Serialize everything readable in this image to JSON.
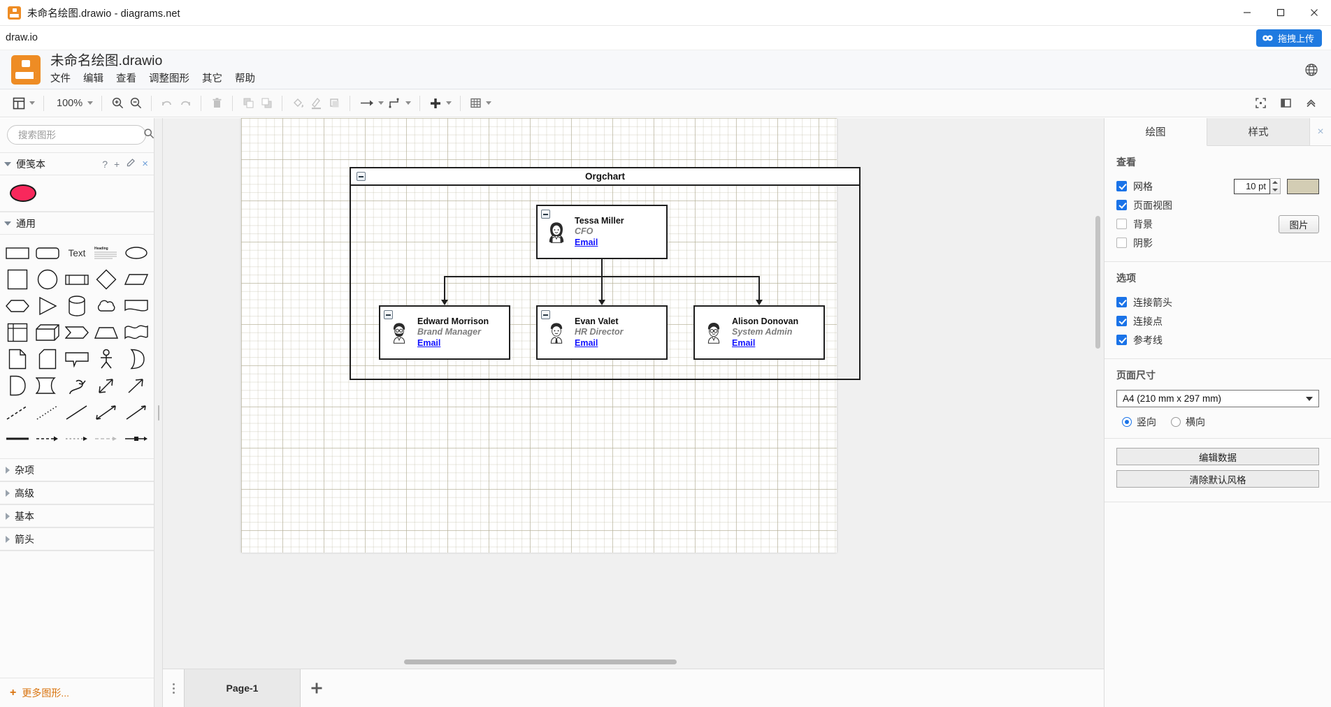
{
  "window": {
    "title": "未命名绘图.drawio - diagrams.net",
    "app_icon": "drawio-logo-icon",
    "controls": {
      "minimize": "minimize-icon",
      "maximize": "maximize-icon",
      "close": "close-icon"
    }
  },
  "brandstrip": {
    "label": "draw.io",
    "upload_button": "拖拽上传",
    "upload_icon": "cloud-upload-icon"
  },
  "header": {
    "file_name": "未命名绘图.drawio",
    "menus": [
      "文件",
      "编辑",
      "查看",
      "调整图形",
      "其它",
      "帮助"
    ],
    "language_icon": "globe-icon"
  },
  "toolbar": {
    "view_icon": "panel-layout-icon",
    "zoom_level": "100%",
    "items": [
      "zoom-in-icon",
      "zoom-out-icon",
      "undo-icon",
      "redo-icon",
      "delete-icon",
      "to-front-icon",
      "to-back-icon",
      "fill-color-icon",
      "line-color-icon",
      "shadow-icon",
      "connection-arrow-icon",
      "waypoints-icon",
      "insert-icon",
      "table-icon"
    ],
    "right_items": [
      "fullscreen-icon",
      "format-panel-icon",
      "collapse-toolbar-icon"
    ]
  },
  "sidebar": {
    "search": {
      "placeholder": "搜索图形",
      "value": "",
      "icon": "search-icon"
    },
    "sections": [
      {
        "label": "便笺本",
        "expanded": true,
        "actions": [
          "?",
          "+",
          "edit-icon",
          "×"
        ]
      },
      {
        "label": "通用",
        "expanded": true
      },
      {
        "label": "杂项",
        "expanded": false
      },
      {
        "label": "高级",
        "expanded": false
      },
      {
        "label": "基本",
        "expanded": false
      },
      {
        "label": "箭头",
        "expanded": false
      }
    ],
    "scratchpad_shape": "pink-ellipse-shape",
    "general_shapes": [
      "rectangle",
      "rounded-rectangle",
      "text",
      "textbox-heading",
      "ellipse",
      "square",
      "circle",
      "process",
      "rhombus",
      "parallelogram",
      "hexagon",
      "triangle",
      "cylinder",
      "cloud",
      "document",
      "internal-storage",
      "cube",
      "step",
      "trapezoid",
      "tape",
      "note",
      "card",
      "callout",
      "actor",
      "or",
      "and",
      "data-storage",
      "curve",
      "bidirectional-arrow",
      "arrow",
      "dashed-line",
      "dotted-line",
      "line",
      "bidirectional-connector",
      "directional-connector",
      "link",
      "dashed-arrow",
      "dotted-arrow",
      "sketch-arrow",
      "box-arrow"
    ],
    "more_shapes": "更多图形...",
    "more_shapes_icon": "plus-icon"
  },
  "canvas": {
    "diagram_title": "Orgchart",
    "cards": [
      {
        "name": "Tessa Miller",
        "role": "CFO",
        "link": "Email",
        "avatar": "woman-avatar-icon"
      },
      {
        "name": "Edward Morrison",
        "role": "Brand Manager",
        "link": "Email",
        "avatar": "bearded-man-avatar-icon"
      },
      {
        "name": "Evan Valet",
        "role": "HR Director",
        "link": "Email",
        "avatar": "man-suit-avatar-icon"
      },
      {
        "name": "Alison Donovan",
        "role": "System Admin",
        "link": "Email",
        "avatar": "glasses-man-avatar-icon"
      }
    ]
  },
  "format_panel": {
    "tabs": [
      {
        "label": "绘图",
        "active": true
      },
      {
        "label": "样式",
        "active": false
      }
    ],
    "close_icon": "close-icon",
    "view_section": {
      "title": "查看",
      "grid": {
        "label": "网格",
        "checked": true,
        "size": "10 pt",
        "color": "#d3cdb4"
      },
      "page_view": {
        "label": "页面视图",
        "checked": true
      },
      "background": {
        "label": "背景",
        "checked": false,
        "button": "图片"
      },
      "shadow": {
        "label": "阴影",
        "checked": false
      }
    },
    "options_section": {
      "title": "选项",
      "items": [
        {
          "label": "连接箭头",
          "checked": true
        },
        {
          "label": "连接点",
          "checked": true
        },
        {
          "label": "参考线",
          "checked": true
        }
      ]
    },
    "paper_section": {
      "title": "页面尺寸",
      "selected": "A4 (210 mm x 297 mm)",
      "orientation": [
        {
          "label": "竖向",
          "selected": true
        },
        {
          "label": "横向",
          "selected": false
        }
      ]
    },
    "buttons": [
      "编辑数据",
      "清除默认风格"
    ]
  },
  "pagebar": {
    "page_tab": "Page-1",
    "add_icon": "plus-icon",
    "drag_handle_icon": "dots-handle-icon"
  }
}
